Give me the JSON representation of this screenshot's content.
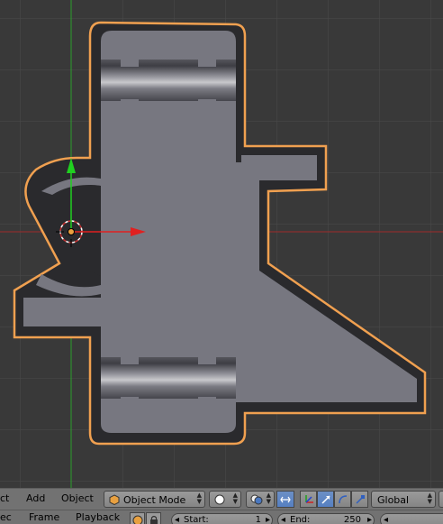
{
  "header": {
    "menu_view_partial": "ct",
    "menu_add": "Add",
    "menu_object": "Object",
    "mode_label": "Object Mode",
    "transform_orientation": "Global"
  },
  "timeline": {
    "menu_view_partial": "ec",
    "menu_frame": "Frame",
    "menu_playback": "Playback",
    "start_label": "Start:",
    "start_value": "1",
    "end_label": "End:",
    "end_value": "250"
  },
  "icons": [
    "object-mode-icon",
    "viewport-shading-icon",
    "pivot-point-icon",
    "snap-icon",
    "manipulator-icon",
    "translate-icon",
    "rotate-icon",
    "scale-icon",
    "record-icon",
    "keying-lock-icon"
  ],
  "colors": {
    "viewport_bg": "#393939",
    "grid": "#4a4a4a",
    "x_axis": "#a02a2a",
    "y_axis": "#2aa02a",
    "mesh_face": "#777780",
    "selection_outline": "#f0a050",
    "header_bg": "#727272",
    "active_button": "#5680c2"
  }
}
